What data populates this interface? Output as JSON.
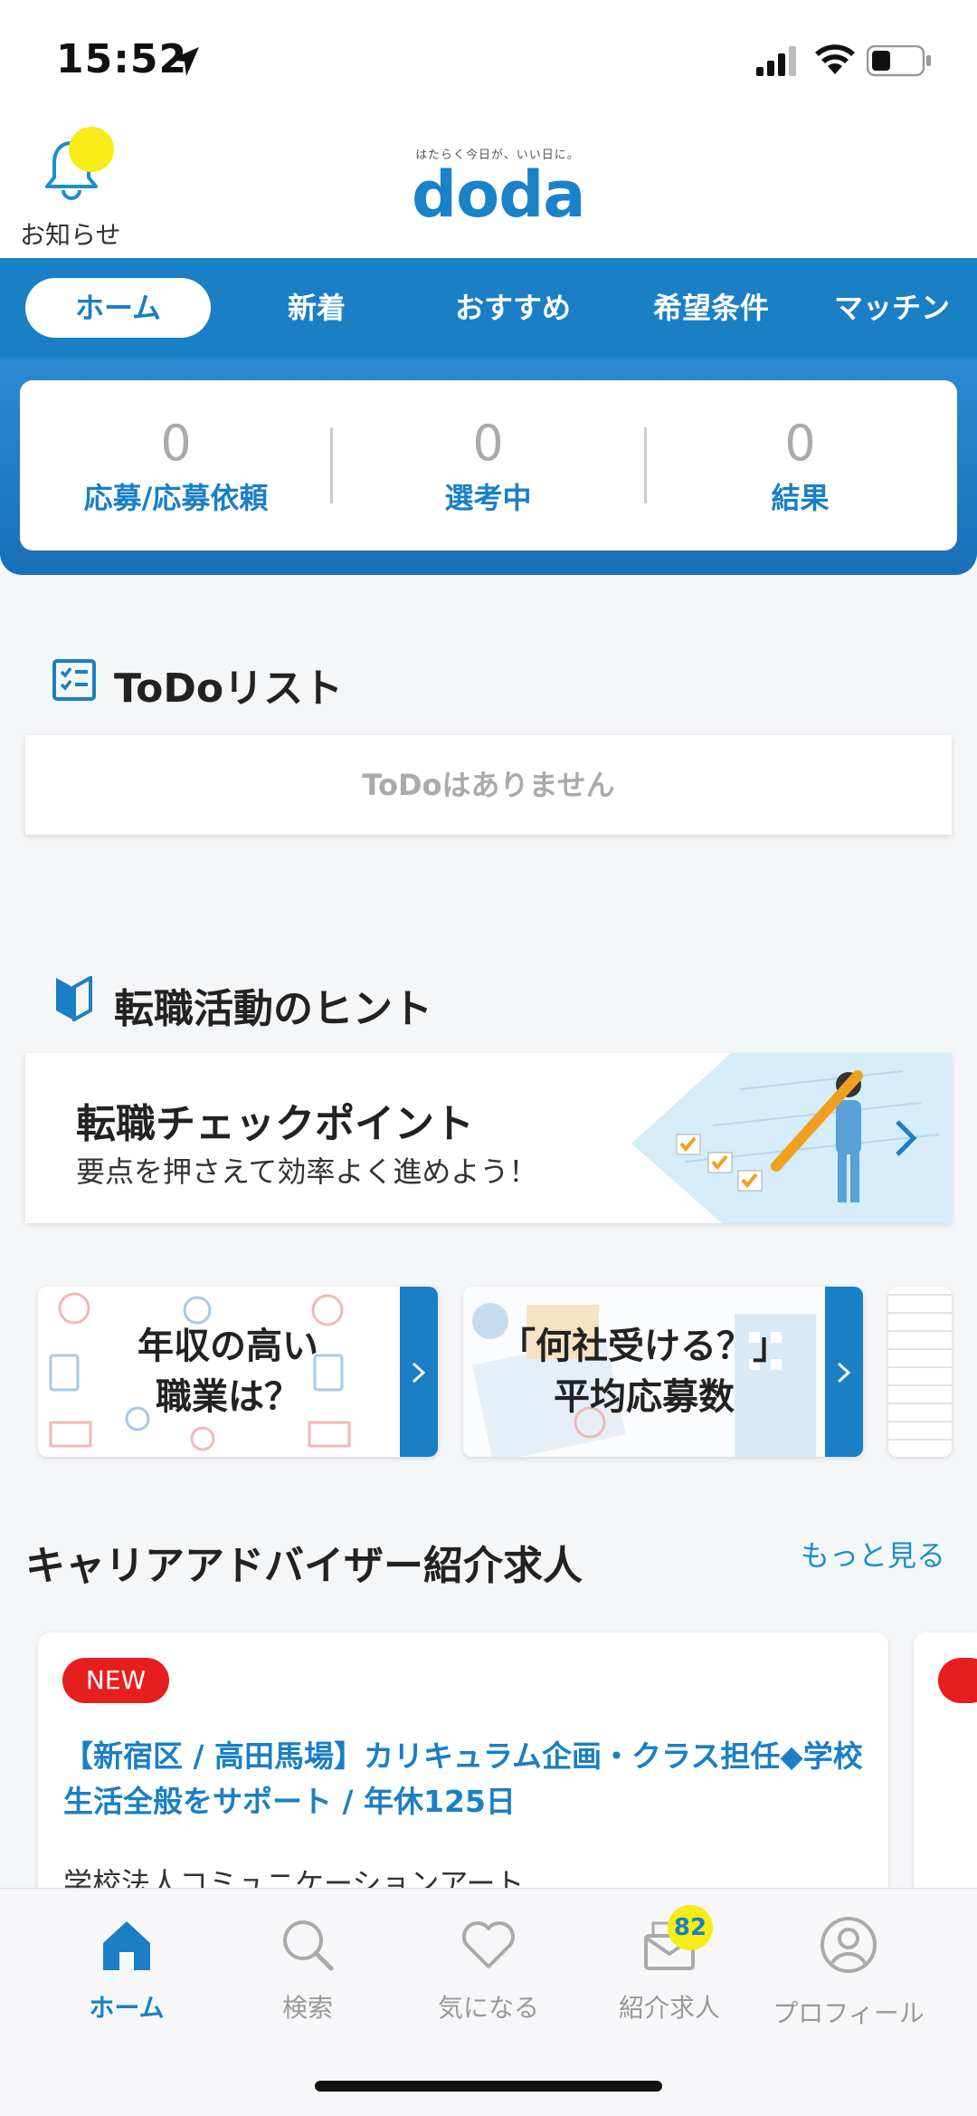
{
  "status_bar": {
    "time": "15:52"
  },
  "header": {
    "notification_label": "お知らせ",
    "logo_tagline": "はたらく今日が、いい日に。",
    "logo_text": "doda"
  },
  "tabs": [
    {
      "label": "ホーム",
      "active": true
    },
    {
      "label": "新着"
    },
    {
      "label": "おすすめ"
    },
    {
      "label": "希望条件"
    },
    {
      "label": "マッチン"
    }
  ],
  "stats": [
    {
      "value": "0",
      "label": "応募/応募依頼"
    },
    {
      "value": "0",
      "label": "選考中"
    },
    {
      "value": "0",
      "label": "結果"
    }
  ],
  "todo": {
    "title": "ToDoリスト",
    "empty_text": "ToDoはありません"
  },
  "hints": {
    "title": "転職活動のヒント",
    "card_title": "転職チェックポイント",
    "card_subtitle": "要点を押さえて効率よく進めよう！",
    "banners": [
      {
        "line1": "年収の高い",
        "line2": "職業は？"
      },
      {
        "line1": "「何社受ける？」",
        "line2": "平均応募数"
      }
    ]
  },
  "career": {
    "title": "キャリアアドバイザー紹介求人",
    "more_label": "もっと見る",
    "job": {
      "badge": "NEW",
      "title": "【新宿区 / 高田馬場】カリキュラム企画・クラス担任◆学校生活全般をサポート / 年休125日",
      "company": "学校法人コミュニケーションアート"
    }
  },
  "bottom_nav": [
    {
      "label": "ホーム",
      "icon": "home-icon",
      "active": true
    },
    {
      "label": "検索",
      "icon": "search-icon"
    },
    {
      "label": "気になる",
      "icon": "heart-icon"
    },
    {
      "label": "紹介求人",
      "icon": "mail-icon",
      "badge": "82"
    },
    {
      "label": "プロフィール",
      "icon": "profile-icon"
    }
  ],
  "colors": {
    "brand_blue": "#1a7fc4",
    "badge_yellow": "#f6ec16",
    "new_red": "#e71e1e"
  }
}
